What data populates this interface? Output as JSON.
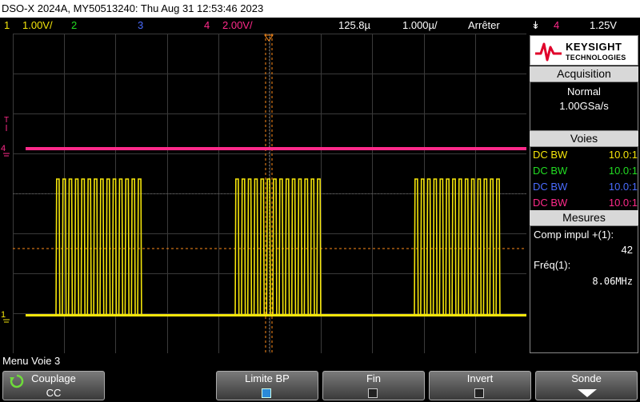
{
  "title_bar": {
    "text": "DSO-X 2024A, MY50513240: Thu Aug 31 12:53:46 2023"
  },
  "status": {
    "ch1_num": "1",
    "ch1_scale": "1.00V/",
    "ch2_num": "2",
    "ch3_num": "3",
    "ch4_num": "4",
    "ch4_scale": "2.00V/",
    "time_pos": "125.8µ",
    "time_scale": "1.000µ/",
    "run_state": "Arrêter",
    "trig_icon": "↡",
    "trig_ch": "4",
    "trig_level": "1.25V"
  },
  "colors": {
    "ch1": "#f5e60a",
    "ch2": "#22dd22",
    "ch3": "#4a6cff",
    "ch4": "#ff2a8a",
    "trigger": "#ff8c1a",
    "grid": "#3a3a3a"
  },
  "markers": {
    "ch1": "1",
    "ch4": "4",
    "trig_t": "T"
  },
  "logo": {
    "line1": "KEYSIGHT",
    "line2": "TECHNOLOGIES"
  },
  "acquisition": {
    "header": "Acquisition",
    "mode": "Normal",
    "rate": "1.00GSa/s"
  },
  "voies": {
    "header": "Voies",
    "rows": [
      {
        "coupling": "DC BW",
        "probe": "10.0:1"
      },
      {
        "coupling": "DC BW",
        "probe": "10.0:1"
      },
      {
        "coupling": "DC BW",
        "probe": "10.0:1"
      },
      {
        "coupling": "DC BW",
        "probe": "10.0:1"
      }
    ]
  },
  "mesures": {
    "header": "Mesures",
    "m1_label": "Comp impul +(1):",
    "m1_value": "42",
    "m2_label": "Fréq(1):",
    "m2_value": "8.06MHz"
  },
  "softkeys": {
    "menu_title": "Menu Voie 3",
    "k1_label": "Couplage",
    "k1_value": "CC",
    "k2_label": "Limite BP",
    "k3_label": "Fin",
    "k4_label": "Invert",
    "k5_label": "Sonde",
    "k2_checked": true,
    "k3_checked": false,
    "k4_checked": false
  },
  "waveform": {
    "bursts": [
      {
        "pulses": 14
      },
      {
        "pulses": 14
      },
      {
        "pulses": 14
      }
    ]
  }
}
